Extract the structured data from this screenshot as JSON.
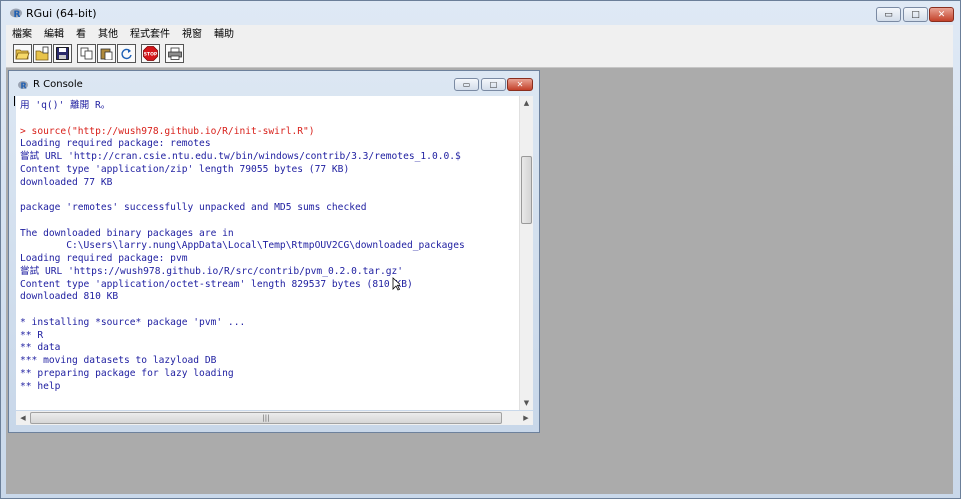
{
  "window": {
    "title": "RGui (64-bit)",
    "min_glyph": "▭",
    "max_glyph": "□",
    "close_glyph": "✕"
  },
  "menu": [
    "檔案",
    "編輯",
    "看",
    "其他",
    "程式套件",
    "視窗",
    "輔助"
  ],
  "toolbar": {
    "tools": [
      {
        "icon": "open-script-icon"
      },
      {
        "icon": "load-workspace-icon"
      },
      {
        "icon": "save-workspace-icon"
      },
      {
        "icon": "copy-icon"
      },
      {
        "icon": "paste-icon"
      },
      {
        "icon": "copy-paste-icon"
      },
      {
        "icon": "stop-icon"
      },
      {
        "icon": "print-icon"
      }
    ],
    "stop_label": "STOP"
  },
  "console": {
    "title": "R Console",
    "lines": [
      {
        "text": "用 'q()' 離開 R。",
        "kind": "out"
      },
      {
        "text": "",
        "kind": "blank"
      },
      {
        "text": "> source(\"http://wush978.github.io/R/init-swirl.R\")",
        "kind": "cmd"
      },
      {
        "text": "Loading required package: remotes",
        "kind": "out"
      },
      {
        "text": "嘗試 URL 'http://cran.csie.ntu.edu.tw/bin/windows/contrib/3.3/remotes_1.0.0.$",
        "kind": "out"
      },
      {
        "text": "Content type 'application/zip' length 79055 bytes (77 KB)",
        "kind": "out"
      },
      {
        "text": "downloaded 77 KB",
        "kind": "out"
      },
      {
        "text": "",
        "kind": "blank"
      },
      {
        "text": "package 'remotes' successfully unpacked and MD5 sums checked",
        "kind": "out"
      },
      {
        "text": "",
        "kind": "blank"
      },
      {
        "text": "The downloaded binary packages are in",
        "kind": "out"
      },
      {
        "text": "        C:\\Users\\larry.nung\\AppData\\Local\\Temp\\RtmpOUV2CG\\downloaded_packages",
        "kind": "out"
      },
      {
        "text": "Loading required package: pvm",
        "kind": "out"
      },
      {
        "text": "嘗試 URL 'https://wush978.github.io/R/src/contrib/pvm_0.2.0.tar.gz'",
        "kind": "out"
      },
      {
        "text": "Content type 'application/octet-stream' length 829537 bytes (810 KB)",
        "kind": "out"
      },
      {
        "text": "downloaded 810 KB",
        "kind": "out"
      },
      {
        "text": "",
        "kind": "blank"
      },
      {
        "text": "* installing *source* package 'pvm' ...",
        "kind": "out"
      },
      {
        "text": "** R",
        "kind": "out"
      },
      {
        "text": "** data",
        "kind": "out"
      },
      {
        "text": "*** moving datasets to lazyload DB",
        "kind": "out"
      },
      {
        "text": "** preparing package for lazy loading",
        "kind": "out"
      },
      {
        "text": "** help",
        "kind": "out"
      }
    ],
    "colors": {
      "output": "#1e1ea0",
      "command": "#d8211b"
    },
    "scroll_up": "▲",
    "scroll_down": "▼",
    "scroll_left": "◀",
    "scroll_right": "▶",
    "hgrip": "|||"
  }
}
